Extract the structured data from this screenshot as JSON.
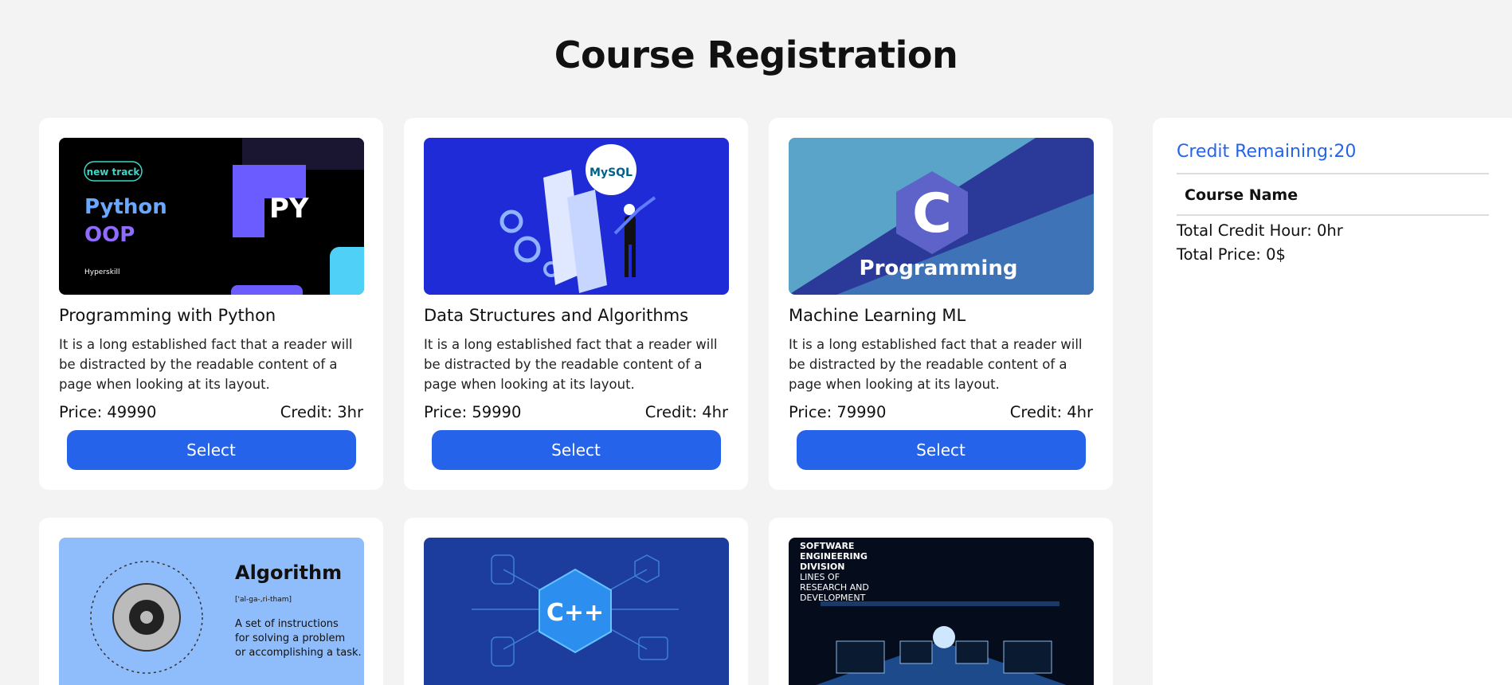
{
  "page": {
    "title": "Course Registration"
  },
  "courses": [
    {
      "title": "Programming with Python",
      "description": "It is a long established fact that a reader will be distracted by the readable content of a page when looking at its layout.",
      "price": "Price: 49990",
      "credit": "Credit: 3hr",
      "button": "Select",
      "thumb": {
        "badge": "new track",
        "line1": "Python",
        "line2": "OOP",
        "logo": "PY",
        "brand": "Hyperskill"
      }
    },
    {
      "title": "Data Structures and Algorithms",
      "description": "It is a long established fact that a reader will be distracted by the readable content of a page when looking at its layout.",
      "price": "Price: 59990",
      "credit": "Credit: 4hr",
      "button": "Select",
      "thumb": {
        "badge": "MySQL"
      }
    },
    {
      "title": "Machine Learning ML",
      "description": "It is a long established fact that a reader will be distracted by the readable content of a page when looking at its layout.",
      "price": "Price: 79990",
      "credit": "Credit: 4hr",
      "button": "Select",
      "thumb": {
        "logo": "C",
        "caption": "Programming"
      }
    },
    {
      "thumb": {
        "heading": "Algorithm",
        "pron": "['al-ga-,ri-tham]",
        "line1": "A set of instructions",
        "line2": "for solving a problem",
        "line3": "or accomplishing a task."
      }
    },
    {
      "thumb": {
        "logo": "C++"
      }
    },
    {
      "thumb": {
        "l1": "SOFTWARE",
        "l2": "ENGINEERING",
        "l3": "DIVISION",
        "l4": "LINES OF",
        "l5": "RESEARCH AND",
        "l6": "DEVELOPMENT"
      }
    }
  ],
  "cart": {
    "credit_remaining": "Credit Remaining:20",
    "course_name_header": "Course Name",
    "total_credit": "Total Credit Hour: 0hr",
    "total_price": "Total Price: 0$"
  },
  "colors": {
    "accent": "#2563eb",
    "background": "#f3f3f3",
    "card": "#ffffff"
  }
}
